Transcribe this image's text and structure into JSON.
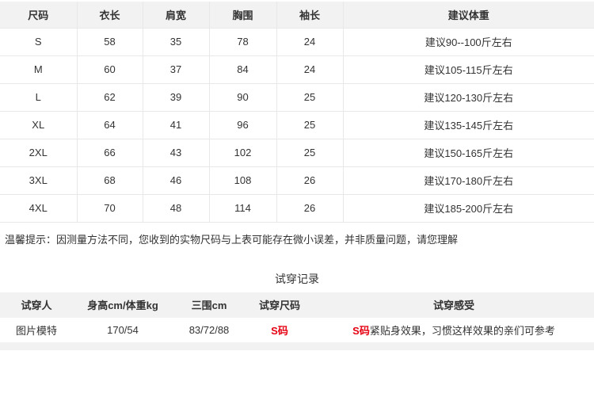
{
  "colors": {
    "header_bg": "#f2f2f2",
    "border": "#e8e8e8",
    "text": "#333333",
    "accent_red": "#e60012"
  },
  "size_table": {
    "headers": [
      "尺码",
      "衣长",
      "肩宽",
      "胸围",
      "袖长",
      "建议体重"
    ],
    "rows": [
      [
        "S",
        "58",
        "35",
        "78",
        "24",
        "建议90--100斤左右"
      ],
      [
        "M",
        "60",
        "37",
        "84",
        "24",
        "建议105-115斤左右"
      ],
      [
        "L",
        "62",
        "39",
        "90",
        "25",
        "建议120-130斤左右"
      ],
      [
        "XL",
        "64",
        "41",
        "96",
        "25",
        "建议135-145斤左右"
      ],
      [
        "2XL",
        "66",
        "43",
        "102",
        "25",
        "建议150-165斤左右"
      ],
      [
        "3XL",
        "68",
        "46",
        "108",
        "26",
        "建议170-180斤左右"
      ],
      [
        "4XL",
        "70",
        "48",
        "114",
        "26",
        "建议185-200斤左右"
      ]
    ]
  },
  "note": "温馨提示：因测量方法不同，您收到的实物尺码与上表可能存在微小误差，并非质量问题，请您理解",
  "fit_section": {
    "title": "试穿记录",
    "headers": [
      "试穿人",
      "身高cm/体重kg",
      "三围cm",
      "试穿尺码",
      "试穿感受"
    ],
    "row": {
      "person": "图片模特",
      "height_weight": "170/54",
      "measurements": "83/72/88",
      "size": "S码",
      "feel_highlight": "S码",
      "feel_text": "紧贴身效果，习惯这样效果的亲们可参考"
    }
  }
}
